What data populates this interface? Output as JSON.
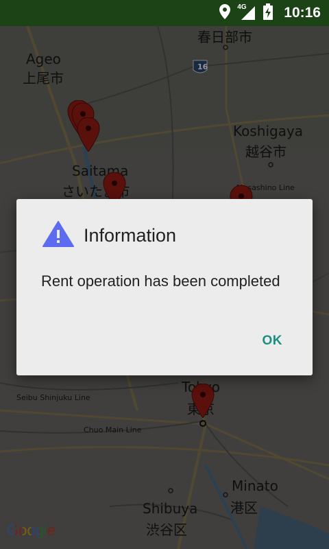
{
  "status_bar": {
    "time": "10:16",
    "network_type": "4G",
    "icons": [
      "location-icon",
      "signal-icon",
      "battery-charging-icon"
    ],
    "background_color": "#1b4316"
  },
  "map": {
    "labels": [
      {
        "id": "kasukabe-jp",
        "text": "春日部市"
      },
      {
        "id": "ageo-en",
        "text": "Ageo"
      },
      {
        "id": "ageo-jp",
        "text": "上尾市"
      },
      {
        "id": "route-16",
        "text": "16"
      },
      {
        "id": "koshigaya-en",
        "text": "Koshigaya"
      },
      {
        "id": "koshigaya-jp",
        "text": "越谷市"
      },
      {
        "id": "saitama-en",
        "text": "Saitama"
      },
      {
        "id": "saitama-jp",
        "text": "さいたま市"
      },
      {
        "id": "musashino-line",
        "text": "Musashino Line"
      },
      {
        "id": "seibu-shinjuku",
        "text": "Seibu Shinjuku Line"
      },
      {
        "id": "chuo-main",
        "text": "Chuo Main Line"
      },
      {
        "id": "tokyo-en",
        "text": "Tokyo"
      },
      {
        "id": "tokyo-jp",
        "text": "東京"
      },
      {
        "id": "minato-en",
        "text": "Minato"
      },
      {
        "id": "minato-jp",
        "text": "港区"
      },
      {
        "id": "shibuya-en",
        "text": "Shibuya"
      },
      {
        "id": "shibuya-jp",
        "text": "渋谷区"
      }
    ],
    "logo_text": "Google",
    "pin_color": "#9b1c14"
  },
  "dialog": {
    "icon": "warning-triangle-icon",
    "icon_color": "#5c6bf0",
    "title": "Information",
    "message": "Rent operation has been completed",
    "ok_label": "OK",
    "accent_color": "#1a8f80"
  }
}
